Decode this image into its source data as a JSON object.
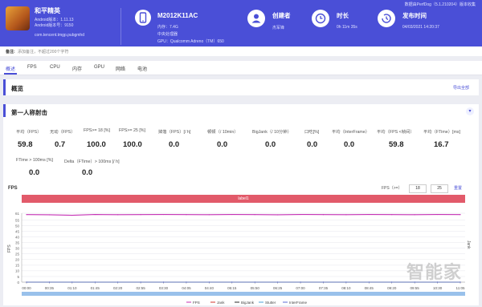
{
  "header": {
    "app": {
      "name": "和平精英",
      "version_line": "Android版本：1.11.13",
      "build_line": "Android版本号：9150",
      "package": "com.tencent.tmgp.pubgmhd"
    },
    "device": {
      "name": "M2012K11AC",
      "ram": "内存：7.4G",
      "cpu": "中央处理器",
      "gpu": "GPU：Qualcomm Adreno（TM）650"
    },
    "creator": {
      "label": "创建者",
      "value": "杰军锋"
    },
    "duration": {
      "label": "时长",
      "value": "0h 11m 35s"
    },
    "publish": {
      "label": "发布时间",
      "value": "04/03/2021 14:20:37"
    },
    "top_links": "数据由PerfDog（5.1.210204）版本收集"
  },
  "note": {
    "label": "备注:",
    "text": "添加备注，不超过200个字符"
  },
  "tabs": [
    "概述",
    "FPS",
    "CPU",
    "内存",
    "GPU",
    "网络",
    "电池"
  ],
  "overview": {
    "title": "概览",
    "export": "导出全部"
  },
  "section": {
    "title": "第一人称射击",
    "collapse_icon": "chevron-down-icon"
  },
  "stats_row1": [
    {
      "label": "平均（FPS）",
      "value": "59.8"
    },
    {
      "label": "无动（FPS）",
      "value": "0.7"
    },
    {
      "label": "FPS>= 18 [%]",
      "value": "100.0"
    },
    {
      "label": "FPS>= 25 [%]",
      "value": "100.0"
    },
    {
      "label": "掉落（FPS）[/ h]",
      "value": "0.0"
    },
    {
      "label": "顿顿（/ 10min）",
      "value": "0.0"
    },
    {
      "label": "BigJank（/ 10分钟）",
      "value": "0.0"
    },
    {
      "label": "口吃[%]",
      "value": "0.0"
    },
    {
      "label": "平均（InterFrame）",
      "value": "0.0"
    },
    {
      "label": "平均（FPS <帧间）",
      "value": "59.8"
    },
    {
      "label": "平均（FTime）[ms]",
      "value": "16.7"
    }
  ],
  "stats_row2": [
    {
      "label": "FTime > 100ms [%]",
      "value": "0.0"
    },
    {
      "label": "Delta（FTime）> 100ms [/ h]",
      "value": "0.0"
    }
  ],
  "fps_panel": {
    "title": "FPS",
    "range_label": "FPS（>=）",
    "threshold1": "18",
    "threshold2": "25",
    "reset": "重置",
    "label_bar": "label1"
  },
  "watermark": "智能家",
  "chart_data": {
    "type": "line",
    "title": "FPS",
    "x": [
      "00:00",
      "00:35",
      "01:10",
      "01:45",
      "02:20",
      "02:55",
      "03:30",
      "04:05",
      "04:40",
      "05:15",
      "05:50",
      "06:25",
      "07:00",
      "07:35",
      "08:10",
      "08:45",
      "09:20",
      "09:55",
      "10:30",
      "11:05"
    ],
    "y_ticks": [
      "61",
      "55",
      "50",
      "45",
      "40",
      "35",
      "30",
      "25",
      "20",
      "15",
      "10",
      "5",
      "0"
    ],
    "ylabel": "FPS",
    "y2label": "Jank",
    "ylim": [
      0,
      61
    ],
    "series": [
      {
        "name": "FPS",
        "color": "#c431b4",
        "values": [
          59.8,
          59.6,
          59.2,
          59.9,
          59.7,
          59.8,
          59.9,
          59.8,
          59.7,
          59.9,
          59.8,
          59.6,
          59.9,
          59.8,
          59.7,
          59.9,
          59.8,
          59.7,
          59.9,
          59.8
        ]
      },
      {
        "name": "Jank",
        "color": "#d0342c",
        "values": [
          0,
          0,
          0,
          0,
          0,
          0,
          0,
          0,
          0,
          0,
          0,
          0,
          0,
          0,
          0,
          0,
          0,
          0,
          0,
          0
        ]
      },
      {
        "name": "BigJank",
        "color": "#2a2a2a",
        "values": [
          0,
          0,
          0,
          0,
          0,
          0,
          0,
          0,
          0,
          0,
          0,
          0,
          0,
          0,
          0,
          0,
          0,
          0,
          0,
          0
        ]
      },
      {
        "name": "Stutter",
        "color": "#4aa3d9",
        "values": [
          0,
          0,
          0,
          0,
          0,
          0,
          0,
          0,
          0,
          0,
          0,
          0,
          0,
          0,
          0,
          0,
          0,
          0,
          0,
          0
        ]
      },
      {
        "name": "InterFrame",
        "color": "#5b6bd6",
        "values": [
          0,
          0,
          0,
          0,
          0,
          0,
          0,
          0,
          0,
          0,
          0,
          0,
          0,
          0,
          0,
          0,
          0,
          0,
          0,
          0
        ]
      }
    ]
  }
}
